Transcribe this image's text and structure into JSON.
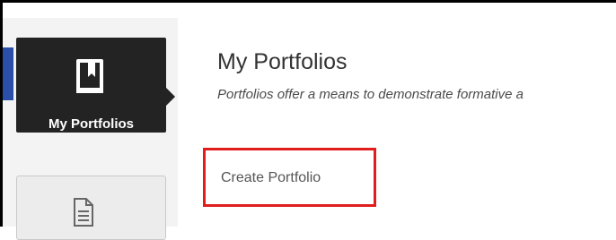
{
  "nav": {
    "active_label": "My Portfolios",
    "active_icon": "book-icon",
    "second_icon": "document-icon",
    "accent_color": "#2a4fa8"
  },
  "main": {
    "title": "My Portfolios",
    "subtitle": "Portfolios offer a means to demonstrate formative a",
    "create_label": "Create Portfolio",
    "highlight_color": "#e11d1d"
  }
}
